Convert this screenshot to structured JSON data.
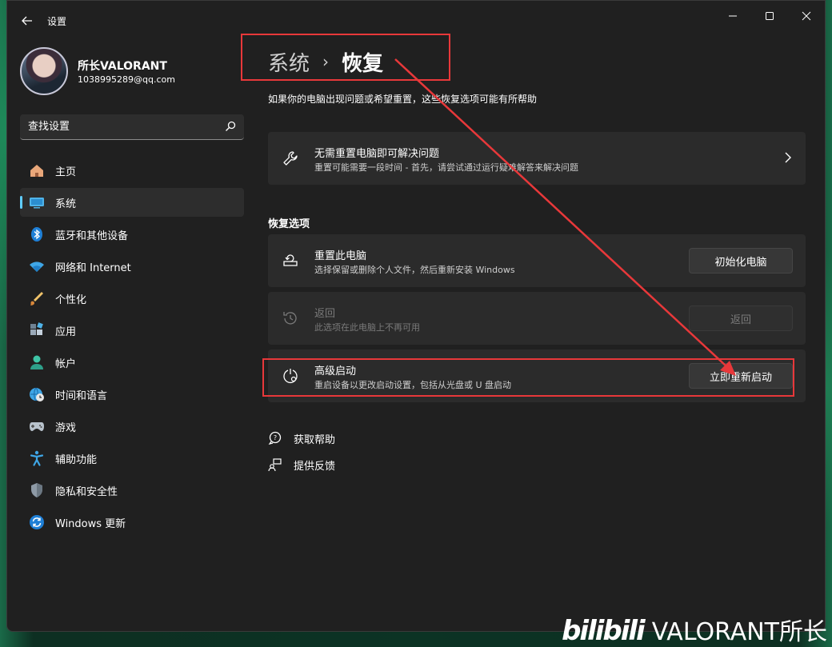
{
  "window": {
    "title": "设置"
  },
  "profile": {
    "name": "所长VALORANT",
    "email": "1038995289@qq.com"
  },
  "search": {
    "placeholder": "查找设置"
  },
  "sidebar": {
    "items": [
      {
        "label": "主页",
        "icon": "home-icon"
      },
      {
        "label": "系统",
        "icon": "system-icon",
        "active": true
      },
      {
        "label": "蓝牙和其他设备",
        "icon": "bluetooth-icon"
      },
      {
        "label": "网络和 Internet",
        "icon": "wifi-icon"
      },
      {
        "label": "个性化",
        "icon": "brush-icon"
      },
      {
        "label": "应用",
        "icon": "apps-icon"
      },
      {
        "label": "帐户",
        "icon": "account-icon"
      },
      {
        "label": "时间和语言",
        "icon": "globe-clock-icon"
      },
      {
        "label": "游戏",
        "icon": "gamepad-icon"
      },
      {
        "label": "辅助功能",
        "icon": "accessibility-icon"
      },
      {
        "label": "隐私和安全性",
        "icon": "shield-icon"
      },
      {
        "label": "Windows 更新",
        "icon": "update-icon"
      }
    ]
  },
  "main": {
    "breadcrumb": {
      "parent": "系统",
      "separator": "›",
      "current": "恢复"
    },
    "description": "如果你的电脑出现问题或希望重置，这些恢复选项可能有所帮助",
    "fix_card": {
      "title": "无需重置电脑即可解决问题",
      "subtitle": "重置可能需要一段时间 - 首先，请尝试通过运行疑难解答来解决问题"
    },
    "section_title": "恢复选项",
    "options": {
      "reset": {
        "title": "重置此电脑",
        "subtitle": "选择保留或删除个人文件，然后重新安装 Windows",
        "button": "初始化电脑"
      },
      "goback": {
        "title": "返回",
        "subtitle": "此选项在此电脑上不再可用",
        "button": "返回"
      },
      "advanced": {
        "title": "高级启动",
        "subtitle": "重启设备以更改启动设置，包括从光盘或 U 盘启动",
        "button": "立即重新启动"
      }
    },
    "links": {
      "help": "获取帮助",
      "feedback": "提供反馈"
    }
  },
  "watermark": {
    "logo": "bilibili",
    "text": "VALORANT所长"
  },
  "colors": {
    "accent": "#60cdff",
    "annotation": "#e8383a",
    "window_bg": "#202020",
    "card_bg": "#2b2b2b"
  }
}
